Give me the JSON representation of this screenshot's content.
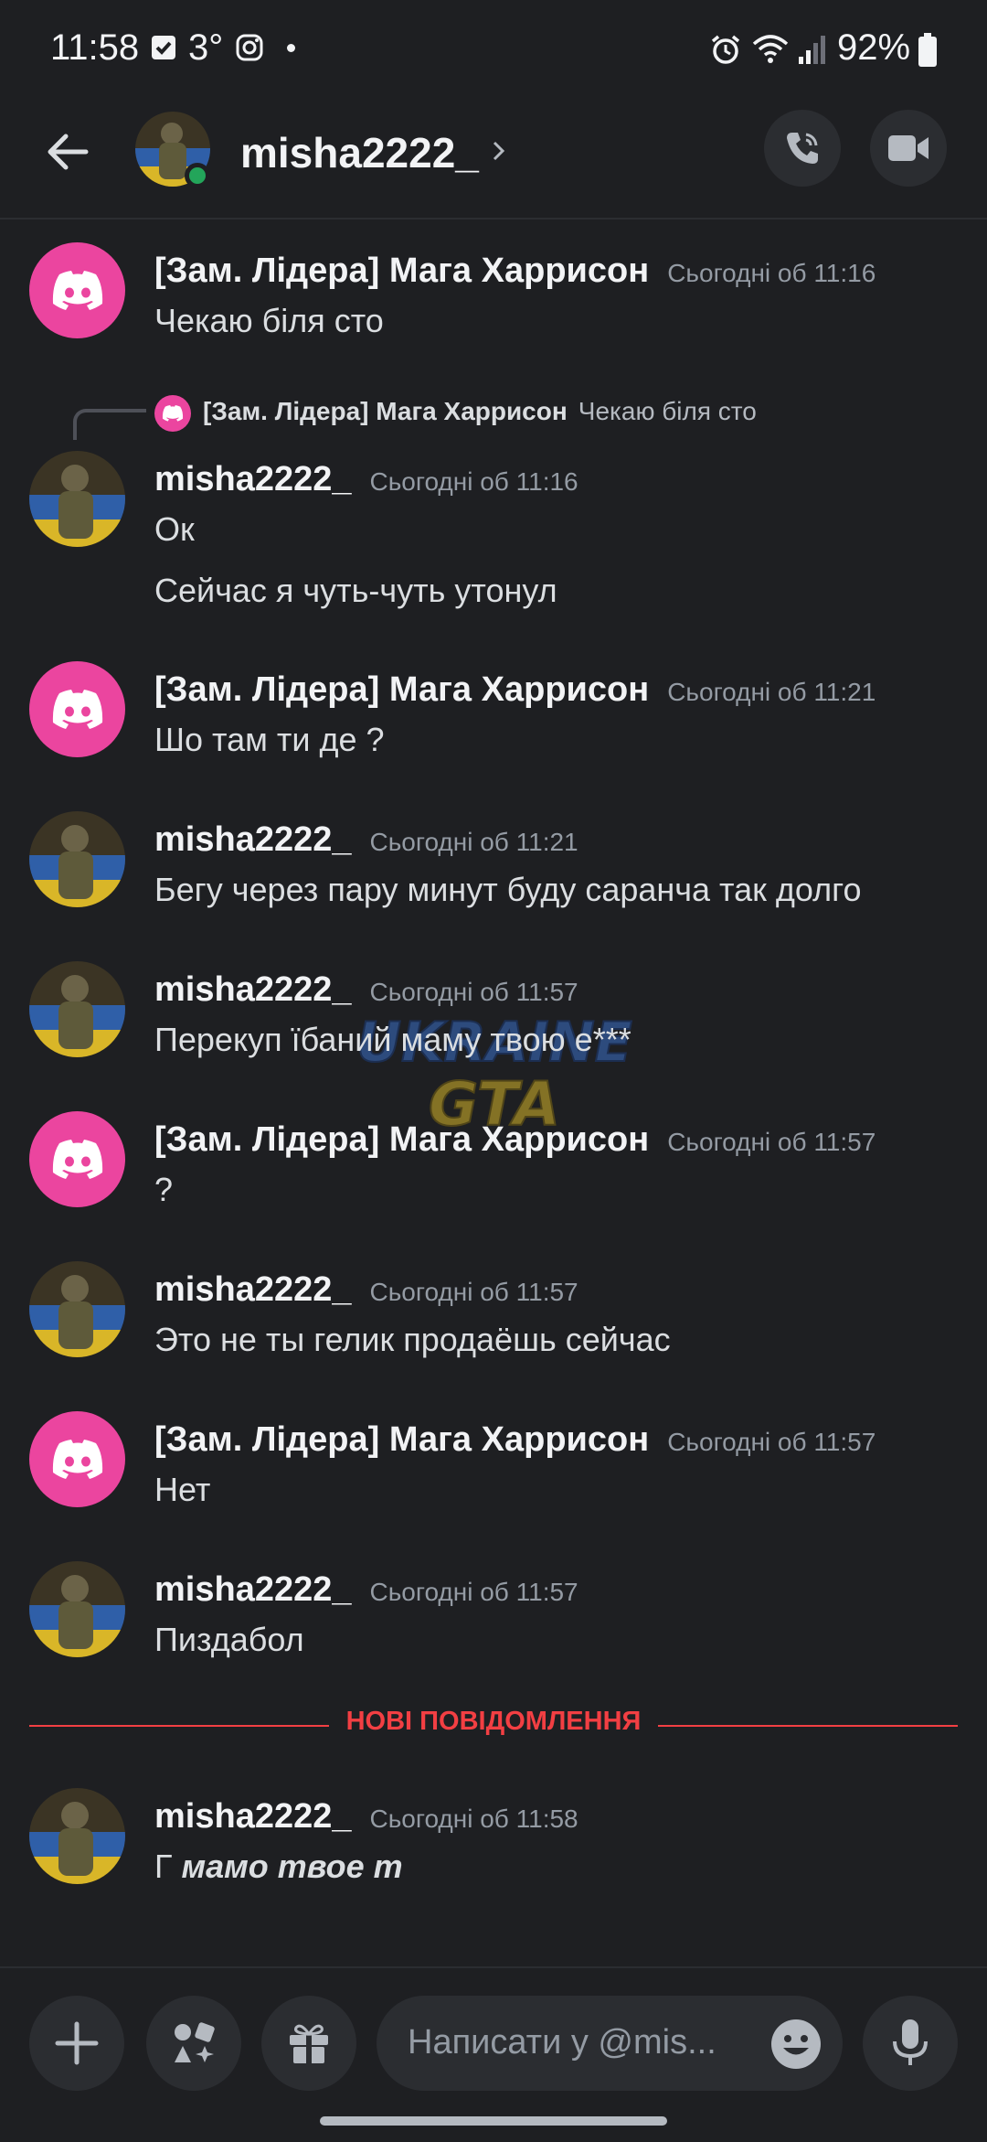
{
  "status_bar": {
    "time": "11:58",
    "temperature": "3°",
    "battery": "92%",
    "icons": [
      "checkbox-icon",
      "instagram-icon",
      "alarm-icon",
      "wifi-icon",
      "signal-icon",
      "battery-icon"
    ]
  },
  "header": {
    "username": "misha2222_",
    "online_color": "#23a55a"
  },
  "messages": [
    {
      "author": "[Зам. Лідера] Мага Харрисон",
      "time": "Сьогодні об 11:16",
      "lines": [
        "Чекаю біля сто"
      ],
      "avatar": "discord-logo"
    },
    {
      "author": "misha2222_",
      "time": "Сьогодні об 11:16",
      "lines": [
        "Ок",
        "Сейчас я чуть-чуть утонул"
      ],
      "avatar": "soldier-photo",
      "reply": {
        "author": "[Зам. Лідера] Мага Харрисон",
        "text": "Чекаю біля сто"
      }
    },
    {
      "author": "[Зам. Лідера] Мага Харрисон",
      "time": "Сьогодні об 11:21",
      "lines": [
        "Шо там ти де ?"
      ],
      "avatar": "discord-logo"
    },
    {
      "author": "misha2222_",
      "time": "Сьогодні об 11:21",
      "lines": [
        "Бегу через пару минут буду саранча так долго"
      ],
      "avatar": "soldier-photo"
    },
    {
      "author": "misha2222_",
      "time": "Сьогодні об 11:57",
      "lines": [
        "Перекуп їбаний маму твою е***"
      ],
      "avatar": "soldier-photo"
    },
    {
      "author": "[Зам. Лідера] Мага Харрисон",
      "time": "Сьогодні об 11:57",
      "lines": [
        "?"
      ],
      "avatar": "discord-logo"
    },
    {
      "author": "misha2222_",
      "time": "Сьогодні об 11:57",
      "lines": [
        "Это не ты гелик продаёшь сейчас"
      ],
      "avatar": "soldier-photo"
    },
    {
      "author": "[Зам. Лідера] Мага Харрисон",
      "time": "Сьогодні об 11:57",
      "lines": [
        "Нет"
      ],
      "avatar": "discord-logo"
    },
    {
      "author": "misha2222_",
      "time": "Сьогодні об 11:57",
      "lines": [
        "Пиздабол"
      ],
      "avatar": "soldier-photo"
    },
    {
      "author": "misha2222_",
      "time": "Сьогодні об 11:58",
      "lines_prefix": "Г",
      "lines_italic": "мамо твое т",
      "avatar": "soldier-photo"
    }
  ],
  "divider_label": "НОВІ ПОВІДОМЛЕННЯ",
  "composer": {
    "placeholder": "Написати у @mis..."
  },
  "watermark_text": [
    "UKRAINE",
    "GTA"
  ],
  "colors": {
    "background": "#1e1f22",
    "discord_pink": "#eb459f",
    "new_messages_red": "#f23f43"
  }
}
